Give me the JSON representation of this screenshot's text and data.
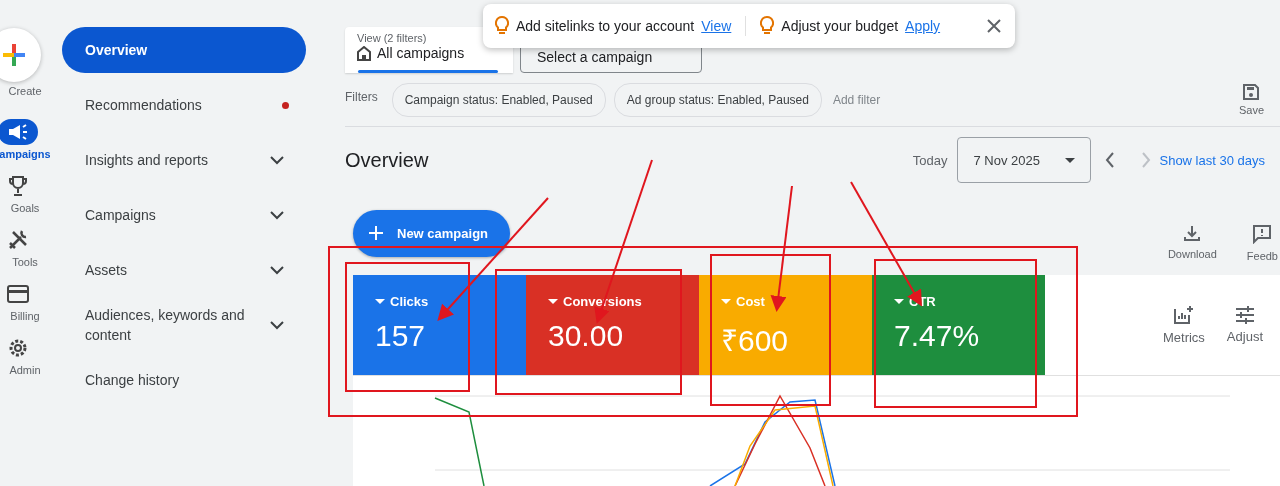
{
  "rail": {
    "items": [
      {
        "kind": "create",
        "label": "Create",
        "selected": false
      },
      {
        "kind": "campaigns",
        "label": "ampaigns",
        "selected": true
      },
      {
        "kind": "goals",
        "label": "Goals",
        "selected": false
      },
      {
        "kind": "tools",
        "label": "Tools",
        "selected": false
      },
      {
        "kind": "billing",
        "label": "Billing",
        "selected": false
      },
      {
        "kind": "admin",
        "label": "Admin",
        "selected": false
      }
    ]
  },
  "nav": {
    "items": [
      {
        "label": "Overview",
        "selected": true,
        "expandable": false,
        "dot": false
      },
      {
        "label": "Recommendations",
        "selected": false,
        "expandable": false,
        "dot": true
      },
      {
        "label": "Insights and reports",
        "selected": false,
        "expandable": true,
        "dot": false
      },
      {
        "label": "Campaigns",
        "selected": false,
        "expandable": true,
        "dot": false
      },
      {
        "label": "Assets",
        "selected": false,
        "expandable": true,
        "dot": false
      },
      {
        "label": "Audiences, keywords and content",
        "selected": false,
        "expandable": true,
        "dot": false
      },
      {
        "label": "Change history",
        "selected": false,
        "expandable": false,
        "dot": false
      }
    ]
  },
  "view_picker": {
    "caption": "View (2 filters)",
    "value": "All campaigns"
  },
  "campaign_picker": {
    "value": "Select a campaign"
  },
  "suggestions": [
    {
      "text": "Add sitelinks to your account",
      "action": "View"
    },
    {
      "text": "Adjust your budget",
      "action": "Apply"
    }
  ],
  "filters": {
    "label": "Filters",
    "chips": [
      "Campaign status: Enabled, Paused",
      "Ad group status: Enabled, Paused"
    ],
    "add": "Add filter"
  },
  "save": {
    "label": "Save"
  },
  "header": {
    "title": "Overview",
    "today": "Today",
    "date": "7 Nov 2025",
    "range_link": "Show last 30 days"
  },
  "new_campaign": {
    "label": "New campaign"
  },
  "tools": [
    {
      "kind": "download",
      "label": "Download"
    },
    {
      "kind": "feedback",
      "label": "Feedb"
    }
  ],
  "metrics": [
    {
      "label": "Clicks",
      "value": "157",
      "color": "#1a73e8"
    },
    {
      "label": "Conversions",
      "value": "30.00",
      "color": "#d93025"
    },
    {
      "label": "Cost",
      "value": "₹600",
      "color": "#f9ab00"
    },
    {
      "label": "CTR",
      "value": "7.47%",
      "color": "#1e8e3e"
    }
  ],
  "metric_actions": [
    {
      "kind": "metrics",
      "label": "Metrics"
    },
    {
      "kind": "adjust",
      "label": "Adjust"
    }
  ]
}
